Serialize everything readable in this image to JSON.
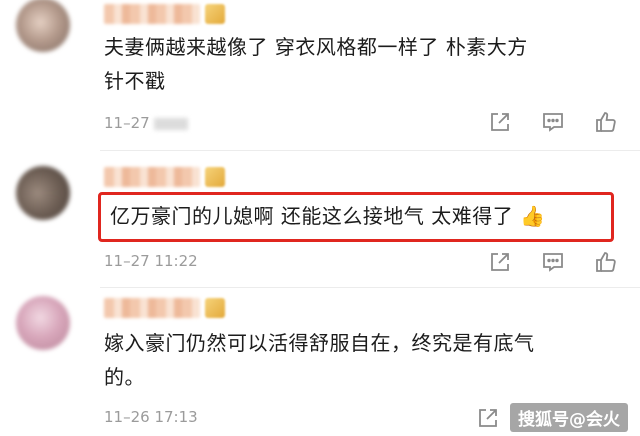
{
  "comments": [
    {
      "text_line1": "夫妻俩越来越像了 穿衣风格都一样了 朴素大方",
      "text_line2": "针不戳",
      "timestamp": "11–27"
    },
    {
      "text": "亿万豪门的儿媳啊 还能这么接地气 太难得了",
      "emoji": "👍",
      "timestamp": "11–27 11:22"
    },
    {
      "text_line1": "嫁入豪门仍然可以活得舒服自在，终究是有底气",
      "text_line2": "的。",
      "timestamp": "11–26 17:13"
    }
  ],
  "actions": {
    "icons": [
      "share-icon",
      "comment-icon",
      "like-icon"
    ]
  },
  "watermark": "搜狐号@会火",
  "colors": {
    "highlight": "#e0261f",
    "meta": "#9b9b9b",
    "icon": "#8a8a8a"
  }
}
